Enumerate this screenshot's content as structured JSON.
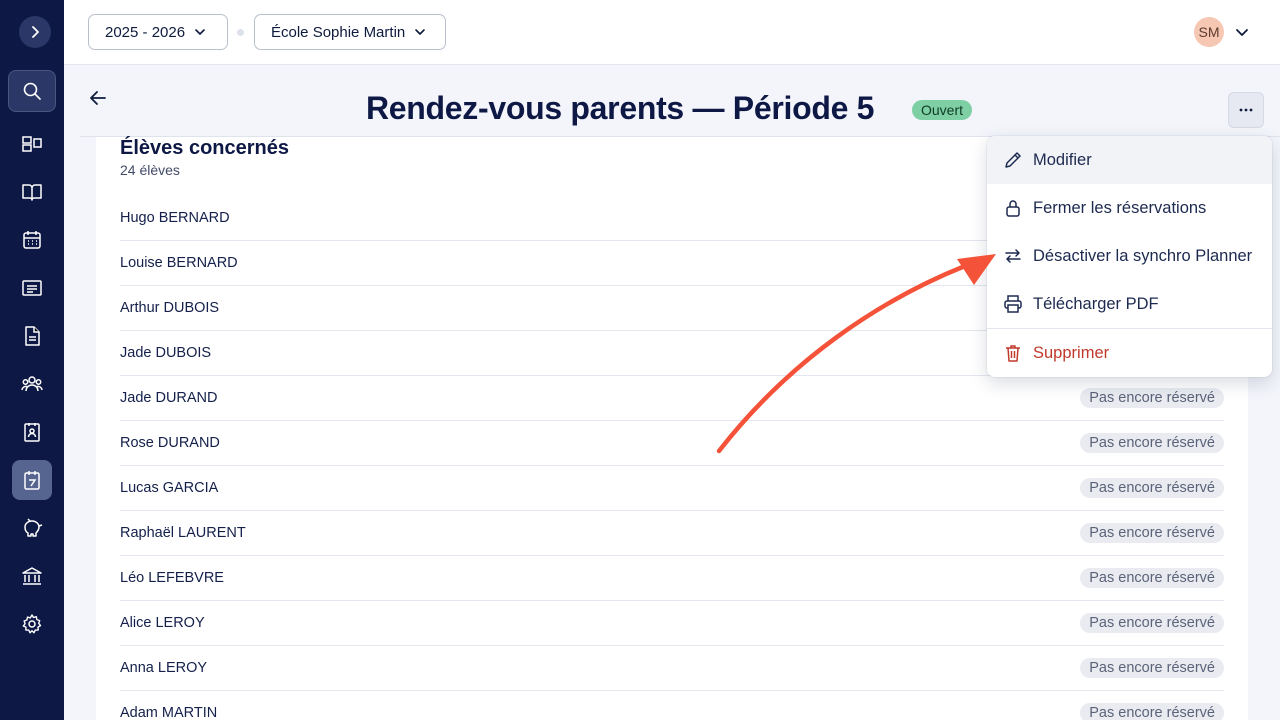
{
  "topbar": {
    "year_select": "2025 - 2026",
    "school_select": "École Sophie Martin",
    "avatar_initials": "SM"
  },
  "sidebar": {
    "items": [
      {
        "icon": "dashboard-icon"
      },
      {
        "icon": "book-icon"
      },
      {
        "icon": "calendar-icon"
      },
      {
        "icon": "presentation-icon"
      },
      {
        "icon": "document-icon"
      },
      {
        "icon": "users-icon"
      },
      {
        "icon": "contacts-icon"
      },
      {
        "icon": "notepad-icon",
        "active": true
      },
      {
        "icon": "piggy-bank-icon"
      },
      {
        "icon": "bank-icon"
      },
      {
        "icon": "settings-icon"
      }
    ]
  },
  "page": {
    "title": "Rendez-vous parents — Période 5",
    "status": "Ouvert"
  },
  "students_card": {
    "title": "Élèves concernés",
    "subtitle": "24 élèves",
    "status_label": "Pas encore réservé",
    "rows": [
      {
        "name": "Hugo BERNARD",
        "status": ""
      },
      {
        "name": "Louise BERNARD",
        "status": ""
      },
      {
        "name": "Arthur DUBOIS",
        "status": ""
      },
      {
        "name": "Jade DUBOIS",
        "status": ""
      },
      {
        "name": "Jade DURAND",
        "status": "Pas encore réservé"
      },
      {
        "name": "Rose DURAND",
        "status": "Pas encore réservé"
      },
      {
        "name": "Lucas GARCIA",
        "status": "Pas encore réservé"
      },
      {
        "name": "Raphaël LAURENT",
        "status": "Pas encore réservé"
      },
      {
        "name": "Léo LEFEBVRE",
        "status": "Pas encore réservé"
      },
      {
        "name": "Alice LEROY",
        "status": "Pas encore réservé"
      },
      {
        "name": "Anna LEROY",
        "status": "Pas encore réservé"
      },
      {
        "name": "Adam MARTIN",
        "status": "Pas encore réservé"
      }
    ]
  },
  "menu": {
    "items": [
      {
        "label": "Modifier",
        "icon": "pencil-icon"
      },
      {
        "label": "Fermer les réservations",
        "icon": "lock-icon"
      },
      {
        "label": "Désactiver la synchro Planner",
        "icon": "sync-arrows-icon"
      },
      {
        "label": "Télécharger PDF",
        "icon": "printer-icon"
      },
      {
        "label": "Supprimer",
        "icon": "trash-icon"
      }
    ]
  },
  "colors": {
    "sidebar_bg": "#0e1845",
    "accent_green": "#7ed0a4",
    "danger": "#c0392b",
    "annotation_arrow": "#f4533a"
  }
}
